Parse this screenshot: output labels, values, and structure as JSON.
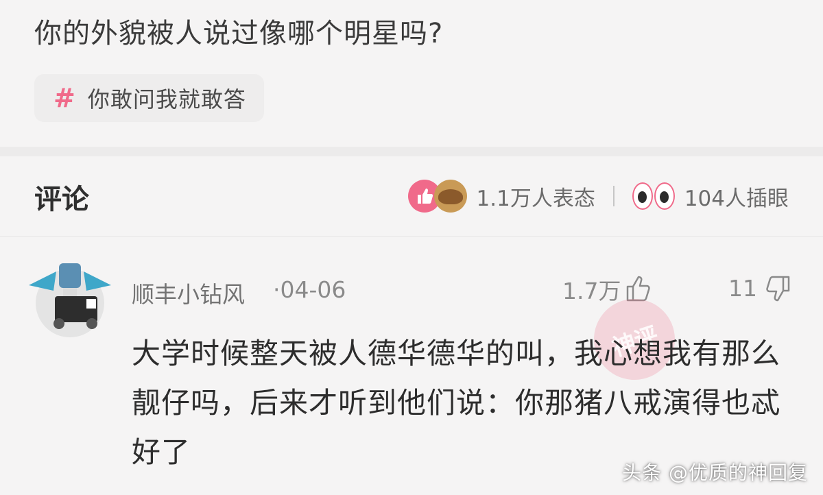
{
  "question": "你的外貌被人说过像哪个明星吗?",
  "tag": {
    "symbol": "#",
    "label": "你敢问我就敢答"
  },
  "comments_header": {
    "title": "评论",
    "reactions_label": "1.1万人表态",
    "peek_label": "104人插眼"
  },
  "comment": {
    "username": "顺丰小钻风",
    "date": "·04-06",
    "like_count": "1.7万",
    "dislike_count": "11",
    "body": "大学时候整天被人德华德华的叫，我心想我有那么靓仔吗，后来才听到他们说：你那猪八戒演得也忒好了",
    "stamp_text": "神评"
  },
  "watermark": "头条 @优质的神回复",
  "colors": {
    "accent": "#f06a8a",
    "background": "#f5f4f4"
  }
}
